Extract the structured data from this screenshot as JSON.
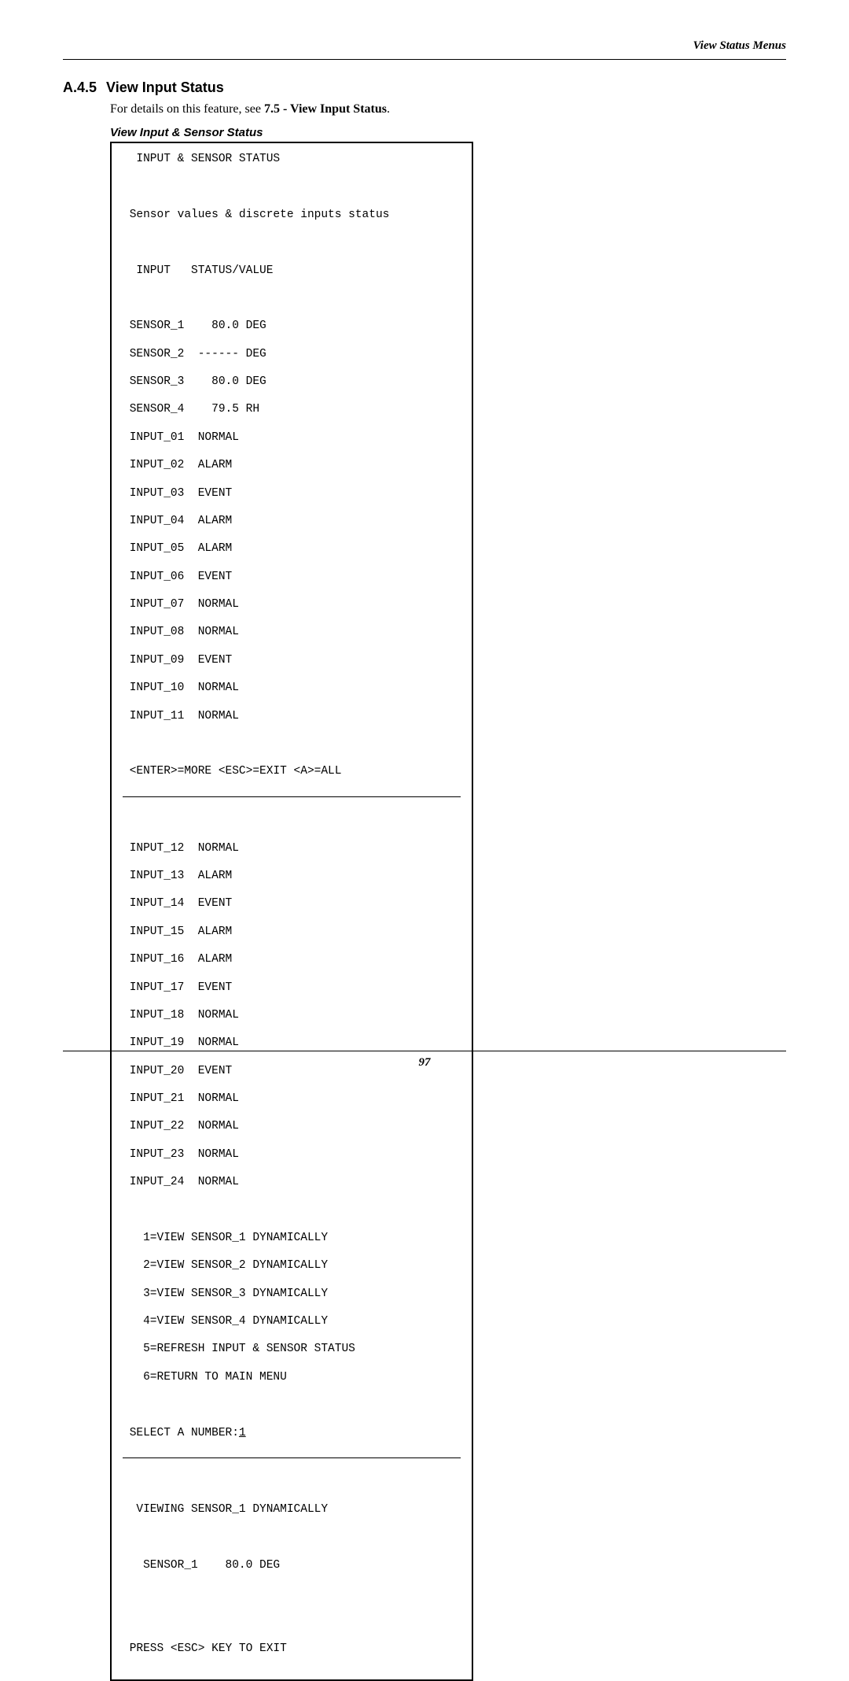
{
  "header": {
    "right": "View Status Menus"
  },
  "section": {
    "number": "A.4.5",
    "title": "View Input Status",
    "intro_prefix": "For details on this feature, see ",
    "intro_bold": "7.5 - View Input Status",
    "intro_suffix": "."
  },
  "box": {
    "title": "View Input & Sensor Status",
    "line_title": "  INPUT & SENSOR STATUS",
    "line_desc": " Sensor values & discrete inputs status",
    "line_header": "  INPUT   STATUS/VALUE",
    "sensors": [
      " SENSOR_1    80.0 DEG",
      " SENSOR_2  ------ DEG",
      " SENSOR_3    80.0 DEG",
      " SENSOR_4    79.5 RH"
    ],
    "inputs_a": [
      " INPUT_01  NORMAL",
      " INPUT_02  ALARM",
      " INPUT_03  EVENT",
      " INPUT_04  ALARM",
      " INPUT_05  ALARM",
      " INPUT_06  EVENT",
      " INPUT_07  NORMAL",
      " INPUT_08  NORMAL",
      " INPUT_09  EVENT",
      " INPUT_10  NORMAL",
      " INPUT_11  NORMAL"
    ],
    "nav": " <ENTER>=MORE <ESC>=EXIT <A>=ALL",
    "inputs_b": [
      " INPUT_12  NORMAL",
      " INPUT_13  ALARM",
      " INPUT_14  EVENT",
      " INPUT_15  ALARM",
      " INPUT_16  ALARM",
      " INPUT_17  EVENT",
      " INPUT_18  NORMAL",
      " INPUT_19  NORMAL",
      " INPUT_20  EVENT",
      " INPUT_21  NORMAL",
      " INPUT_22  NORMAL",
      " INPUT_23  NORMAL",
      " INPUT_24  NORMAL"
    ],
    "menu": [
      "   1=VIEW SENSOR_1 DYNAMICALLY",
      "   2=VIEW SENSOR_2 DYNAMICALLY",
      "   3=VIEW SENSOR_3 DYNAMICALLY",
      "   4=VIEW SENSOR_4 DYNAMICALLY",
      "   5=REFRESH INPUT & SENSOR STATUS",
      "   6=RETURN TO MAIN MENU"
    ],
    "select_prefix": " SELECT A NUMBER:",
    "select_value": "1",
    "viewing": "  VIEWING SENSOR_1 DYNAMICALLY",
    "viewing_value": "   SENSOR_1    80.0 DEG",
    "exit": " PRESS <ESC> KEY TO EXIT"
  },
  "footer": {
    "page": "97"
  }
}
